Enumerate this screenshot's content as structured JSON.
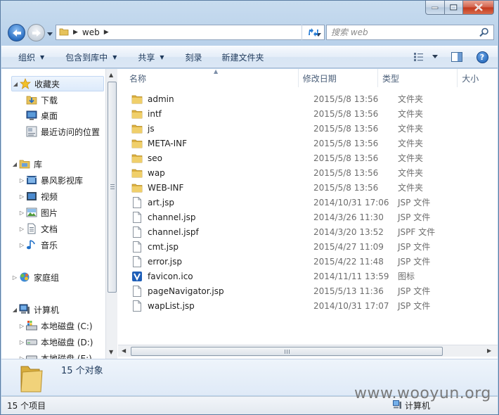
{
  "window": {
    "address": {
      "crumb": "web"
    },
    "search": {
      "placeholder": "搜索 web"
    }
  },
  "toolbar": {
    "organize": "组织",
    "include_library": "包含到库中",
    "share": "共享",
    "burn": "刻录",
    "new_folder": "新建文件夹"
  },
  "nav": {
    "favorites": "收藏夹",
    "downloads": "下载",
    "desktop": "桌面",
    "recent": "最近访问的位置",
    "libraries": "库",
    "storm_video": "暴风影视库",
    "videos": "视频",
    "pictures": "图片",
    "documents": "文档",
    "music": "音乐",
    "homegroup": "家庭组",
    "computer": "计算机",
    "disk_c": "本地磁盘 (C:)",
    "disk_d": "本地磁盘 (D:)",
    "disk_e": "本地磁盘 (E:)"
  },
  "columns": {
    "name": "名称",
    "date": "修改日期",
    "type": "类型",
    "size": "大小"
  },
  "files": [
    {
      "name": "admin",
      "date": "2015/5/8 13:56",
      "type": "文件夹",
      "icon": "folder-icon"
    },
    {
      "name": "intf",
      "date": "2015/5/8 13:56",
      "type": "文件夹",
      "icon": "folder-icon"
    },
    {
      "name": "js",
      "date": "2015/5/8 13:56",
      "type": "文件夹",
      "icon": "folder-icon"
    },
    {
      "name": "META-INF",
      "date": "2015/5/8 13:56",
      "type": "文件夹",
      "icon": "folder-icon"
    },
    {
      "name": "seo",
      "date": "2015/5/8 13:56",
      "type": "文件夹",
      "icon": "folder-icon"
    },
    {
      "name": "wap",
      "date": "2015/5/8 13:56",
      "type": "文件夹",
      "icon": "folder-icon"
    },
    {
      "name": "WEB-INF",
      "date": "2015/5/8 13:56",
      "type": "文件夹",
      "icon": "folder-icon"
    },
    {
      "name": "art.jsp",
      "date": "2014/10/31 17:06",
      "type": "JSP 文件",
      "icon": "file-icon"
    },
    {
      "name": "channel.jsp",
      "date": "2014/3/26 11:30",
      "type": "JSP 文件",
      "icon": "file-icon"
    },
    {
      "name": "channel.jspf",
      "date": "2014/3/20 13:52",
      "type": "JSPF 文件",
      "icon": "file-icon"
    },
    {
      "name": "cmt.jsp",
      "date": "2015/4/27 11:09",
      "type": "JSP 文件",
      "icon": "file-icon"
    },
    {
      "name": "error.jsp",
      "date": "2015/4/22 11:48",
      "type": "JSP 文件",
      "icon": "file-icon"
    },
    {
      "name": "favicon.ico",
      "date": "2014/11/11 13:59",
      "type": "图标",
      "icon": "favicon-icon"
    },
    {
      "name": "pageNavigator.jsp",
      "date": "2015/5/13 11:36",
      "type": "JSP 文件",
      "icon": "file-icon"
    },
    {
      "name": "wapList.jsp",
      "date": "2014/10/31 17:07",
      "type": "JSP 文件",
      "icon": "file-icon"
    }
  ],
  "details": {
    "count": "15 个对象"
  },
  "status": {
    "items": "15 个项目",
    "location": "计算机"
  },
  "watermark": "www.wooyun.org"
}
